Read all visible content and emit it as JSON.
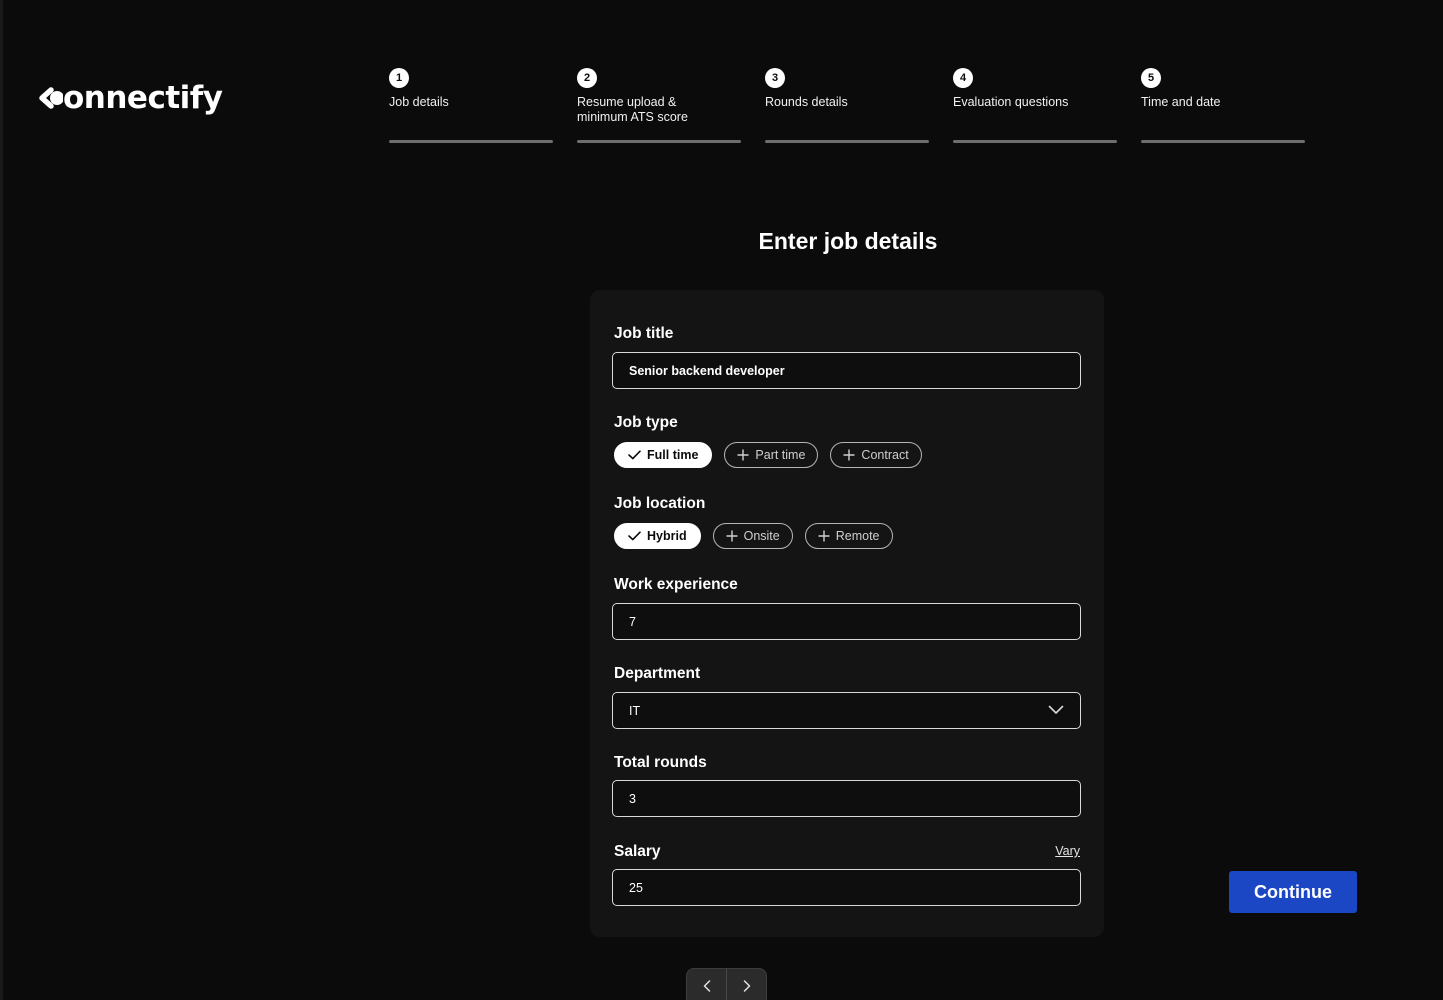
{
  "app": {
    "name": "onnectify"
  },
  "steps": [
    {
      "number": "1",
      "label": "Job details"
    },
    {
      "number": "2",
      "label": "Resume upload & minimum ATS score"
    },
    {
      "number": "3",
      "label": "Rounds details"
    },
    {
      "number": "4",
      "label": "Evaluation questions"
    },
    {
      "number": "5",
      "label": "Time and date"
    }
  ],
  "page": {
    "title": "Enter job details"
  },
  "form": {
    "job_title": {
      "label": "Job title",
      "value": "Senior backend developer"
    },
    "job_type": {
      "label": "Job type",
      "options": [
        {
          "label": "Full time",
          "selected": true
        },
        {
          "label": "Part time",
          "selected": false
        },
        {
          "label": "Contract",
          "selected": false
        }
      ]
    },
    "job_location": {
      "label": "Job location",
      "options": [
        {
          "label": "Hybrid",
          "selected": true
        },
        {
          "label": "Onsite",
          "selected": false
        },
        {
          "label": "Remote",
          "selected": false
        }
      ]
    },
    "work_experience": {
      "label": "Work experience",
      "value": "7"
    },
    "department": {
      "label": "Department",
      "value": "IT"
    },
    "total_rounds": {
      "label": "Total rounds",
      "value": "3"
    },
    "salary": {
      "label": "Salary",
      "value": "25",
      "link": "Vary"
    }
  },
  "actions": {
    "continue_label": "Continue"
  },
  "icons": {
    "check": "check-icon",
    "plus": "plus-icon",
    "chevron": "chevron-down-icon",
    "prev": "chevron-left-icon",
    "next": "chevron-right-icon"
  },
  "colors": {
    "background": "#0b0b0b",
    "card": "#141414",
    "primary": "#1c47c4"
  }
}
